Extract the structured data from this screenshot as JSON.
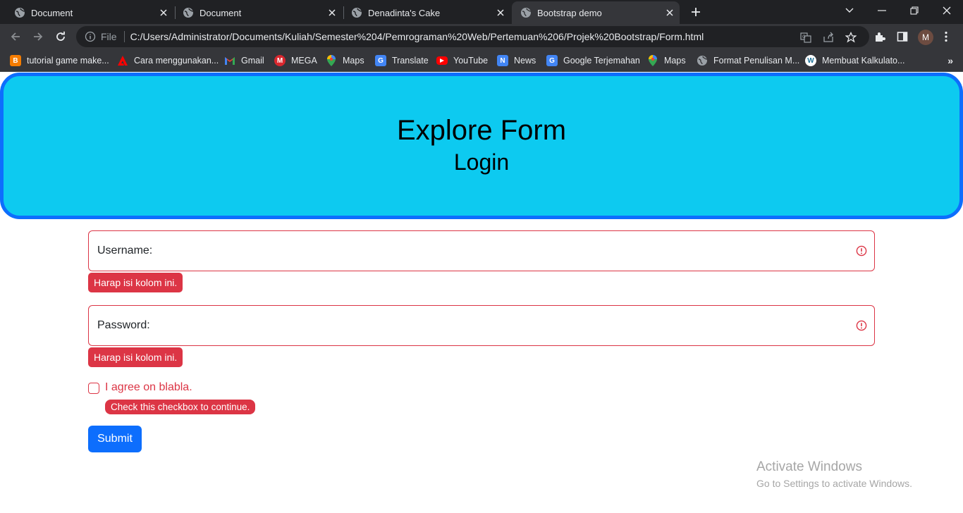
{
  "browser": {
    "tabs": [
      {
        "title": "Document",
        "active": false
      },
      {
        "title": "Document",
        "active": false
      },
      {
        "title": "Denadinta's Cake",
        "active": false
      },
      {
        "title": "Bootstrap demo",
        "active": true
      }
    ],
    "address": {
      "scheme_label": "File",
      "url": "C:/Users/Administrator/Documents/Kuliah/Semester%204/Pemrograman%20Web/Pertemuan%206/Projek%20Bootstrap/Form.html"
    },
    "profile_initial": "M",
    "bookmarks": [
      {
        "label": "tutorial game make...",
        "icon": "blogger-icon",
        "color": "#f57c00"
      },
      {
        "label": "Cara menggunakan...",
        "icon": "adobe-icon",
        "color": "#ff0000"
      },
      {
        "label": "Gmail",
        "icon": "gmail-icon",
        "color": "#ea4335"
      },
      {
        "label": "MEGA",
        "icon": "mega-icon",
        "color": "#d9272e"
      },
      {
        "label": "Maps",
        "icon": "maps-icon",
        "color": "#34a853"
      },
      {
        "label": "Translate",
        "icon": "translate-icon",
        "color": "#4285f4"
      },
      {
        "label": "YouTube",
        "icon": "youtube-icon",
        "color": "#ff0000"
      },
      {
        "label": "News",
        "icon": "news-icon",
        "color": "#4285f4"
      },
      {
        "label": "Google Terjemahan",
        "icon": "translate-icon",
        "color": "#4285f4"
      },
      {
        "label": "Maps",
        "icon": "maps-icon",
        "color": "#34a853"
      },
      {
        "label": "Format Penulisan M...",
        "icon": "globe-icon",
        "color": "#9aa0a6"
      },
      {
        "label": "Membuat Kalkulato...",
        "icon": "wordpress-icon",
        "color": "#21759b"
      }
    ]
  },
  "page": {
    "title": "Explore Form",
    "subtitle": "Login",
    "username_label": "Username:",
    "password_label": "Password:",
    "field_error": "Harap isi kolom ini.",
    "checkbox_label": "I agree on blabla.",
    "checkbox_error": "Check this checkbox to continue.",
    "submit_label": "Submit"
  },
  "watermark": {
    "title": "Activate Windows",
    "subtitle": "Go to Settings to activate Windows."
  },
  "colors": {
    "hero_bg": "#0dcaf0",
    "hero_border": "#0d6efd",
    "danger": "#dc3545",
    "primary": "#0d6efd"
  }
}
